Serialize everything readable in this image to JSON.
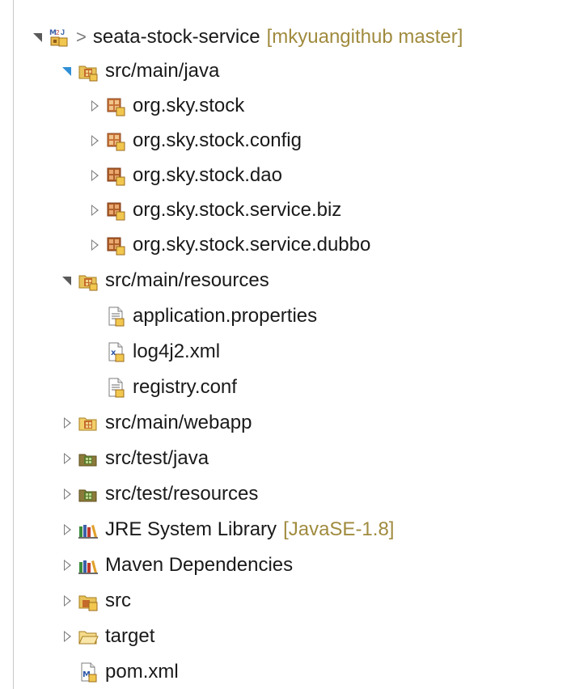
{
  "project": {
    "name": "seata-stock-service",
    "prefix": ">",
    "decoration": "[mkyuangithub master]"
  },
  "tree": {
    "src_main_java": "src/main/java",
    "pkg_stock": "org.sky.stock",
    "pkg_config": "org.sky.stock.config",
    "pkg_dao": "org.sky.stock.dao",
    "pkg_biz": "org.sky.stock.service.biz",
    "pkg_dubbo": "org.sky.stock.service.dubbo",
    "src_main_resources": "src/main/resources",
    "file_app_props": "application.properties",
    "file_log4j2": "log4j2.xml",
    "file_registry": "registry.conf",
    "src_main_webapp": "src/main/webapp",
    "src_test_java": "src/test/java",
    "src_test_resources": "src/test/resources",
    "jre_library": "JRE System Library",
    "jre_version": "[JavaSE-1.8]",
    "maven_deps": "Maven Dependencies",
    "folder_src": "src",
    "folder_target": "target",
    "file_pom": "pom.xml"
  },
  "colors": {
    "decoration": "#a08b3e",
    "package_brown": "#b0602a",
    "folder_yellow": "#e8c35a",
    "test_green": "#5b7a2e",
    "expanded_arrow_blue": "#2f8fd6"
  },
  "icons": {
    "project": "maven-project-icon",
    "source_folder": "source-folder-icon",
    "package": "package-icon",
    "file": "properties-file-icon",
    "xml": "xml-file-icon",
    "library": "library-icon",
    "folder": "folder-icon",
    "pom": "maven-pom-icon"
  }
}
